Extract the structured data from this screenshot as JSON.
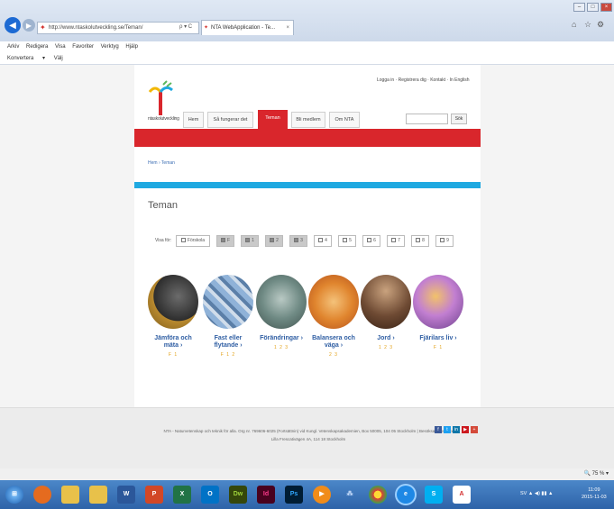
{
  "browser": {
    "address_url": "http://www.ntaskolutveckling.se/Teman/",
    "address_icons": "ρ ▾ C",
    "tab_title": "NTA WebApplication - Te...",
    "tab_close": "×",
    "menu": [
      "Arkiv",
      "Redigera",
      "Visa",
      "Favoriter",
      "Verktyg",
      "Hjälp"
    ],
    "favbar": [
      "Konvertera",
      "▾",
      "Välj"
    ]
  },
  "site": {
    "logo_text": "ntaskolutveckling",
    "top_links": "Logga in  ·  Registrera dig  ·  Kontakt  ·  In English",
    "nav": [
      "Hem",
      "Så fungerar det",
      "Teman",
      "Bli medlem",
      "Om NTA"
    ],
    "search_button": "Sök",
    "breadcrumb": "Hem › Teman",
    "page_title": "Teman",
    "filter_label": "Visa för:",
    "filters": [
      {
        "label": "Förskola",
        "checked": false
      },
      {
        "label": "F",
        "checked": true
      },
      {
        "label": "1",
        "checked": true
      },
      {
        "label": "2",
        "checked": true
      },
      {
        "label": "3",
        "checked": true
      },
      {
        "label": "4",
        "checked": false
      },
      {
        "label": "5",
        "checked": false
      },
      {
        "label": "6",
        "checked": false
      },
      {
        "label": "7",
        "checked": false
      },
      {
        "label": "8",
        "checked": false
      },
      {
        "label": "9",
        "checked": false
      }
    ],
    "themes": [
      {
        "name": "Jämföra och mäta ›",
        "levels": "F 1"
      },
      {
        "name": "Fast eller flytande ›",
        "levels": "F 1 2"
      },
      {
        "name": "Förändringar ›",
        "levels": "1 2 3"
      },
      {
        "name": "Balansera och väga ›",
        "levels": "2 3"
      },
      {
        "name": "Jord ›",
        "levels": "1 2 3"
      },
      {
        "name": "Fjärilars liv ›",
        "levels": "F 1"
      }
    ],
    "footer_line1": "NTA - Naturvetenskap och teknik för alla. Org nr. 769606-6025 (Fortsättnin) vid Kungl. Vetenskapsakademien, Box 50005, 104 05 Stockholm | Besöksadress: xxx",
    "footer_line2": "Lilla Frescativägen 4A, 114 18 Stockholm",
    "social": [
      "f",
      "t",
      "in",
      "▶",
      "+"
    ]
  },
  "status": {
    "zoom": "75 %"
  },
  "taskbar": {
    "tray": "SV  ▲  ◀)  ▮▮  ▲",
    "time": "11:09",
    "date": "2015-11-03"
  },
  "colors": {
    "brand_red": "#d9262c",
    "accent_blue": "#1fa9e1",
    "link_blue": "#2f5ea3",
    "level_gold": "#e3a21a"
  }
}
